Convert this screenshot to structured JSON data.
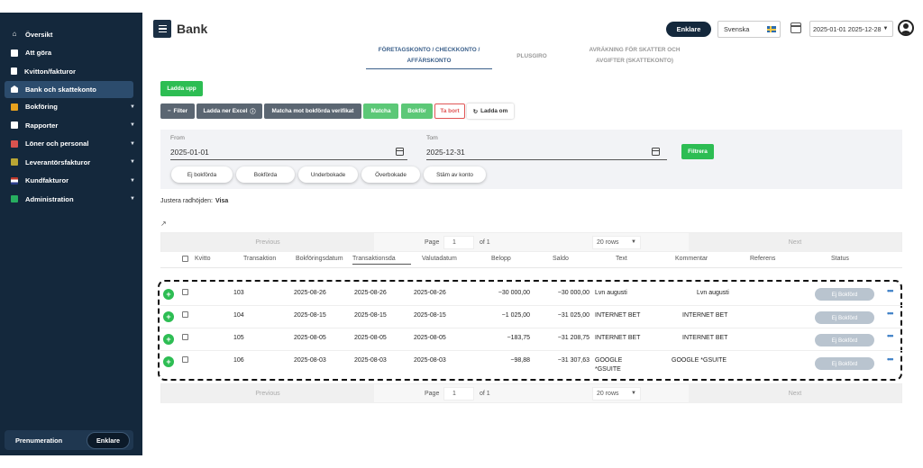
{
  "sidebar": {
    "items": [
      {
        "label": "Översikt",
        "icon": "house-icon"
      },
      {
        "label": "Att göra",
        "icon": "list-icon"
      },
      {
        "label": "Kvitton/fakturor",
        "icon": "document-icon"
      },
      {
        "label": "Bank och skattekonto",
        "icon": "bank-icon"
      },
      {
        "label": "Bokföring",
        "icon": "ledger-icon"
      },
      {
        "label": "Rapporter",
        "icon": "report-icon"
      },
      {
        "label": "Löner och personal",
        "icon": "payroll-icon"
      },
      {
        "label": "Leverantörsfakturor",
        "icon": "supplier-icon"
      },
      {
        "label": "Kundfakturor",
        "icon": "flag-icon"
      },
      {
        "label": "Administration",
        "icon": "admin-icon"
      }
    ],
    "bottom_label": "Prenumeration",
    "bottom_button": "Enklare"
  },
  "header": {
    "title": "Bank",
    "enklare": "Enklare",
    "language": "Svenska",
    "date_range": "2025-01-01 2025-12-28"
  },
  "tabs": {
    "t1_line1": "FÖRETAGSKONTO / CHECKKONTO /",
    "t1_line2": "AFFÄRSKONTO",
    "t2": "PLUSGIRO",
    "t3_line1": "AVRÄKNING FÖR SKATTER OCH",
    "t3_line2": "AVGIFTER (SKATTEKONTO)"
  },
  "toolbar": {
    "upload": "Ladda upp",
    "filter": "Filter",
    "download_excel": "Ladda ner Excel",
    "match_verifications": "Matcha mot bokförda verifikat",
    "match": "Matcha",
    "book": "Bokför",
    "delete": "Ta bort",
    "reload": "Ladda om"
  },
  "filters": {
    "from_label": "From",
    "from_value": "2025-01-01",
    "to_label": "Tom",
    "to_value": "2025-12-31",
    "filter_button": "Filtrera",
    "pills": [
      "Ej bokförda",
      "Bokförda",
      "Underbokade",
      "Överbokade",
      "Stäm av konto"
    ]
  },
  "row_height": {
    "label": "Justera radhöjden:",
    "value": "Visa"
  },
  "pager": {
    "previous": "Previous",
    "page_label": "Page",
    "page_value": "1",
    "of": "of 1",
    "rows": "20 rows",
    "next": "Next"
  },
  "columns": [
    "Kvitto",
    "Transaktion",
    "Bokföringsdatum",
    "Transaktionsda",
    "Valutadatum",
    "Belopp",
    "Saldo",
    "Text",
    "Kommentar",
    "Referens",
    "Status"
  ],
  "rows": [
    {
      "transaction": "103",
      "booking_date": "2025-08-26",
      "transaction_date": "2025-08-26",
      "value_date": "2025-08-26",
      "amount": "−30 000,00",
      "balance": "−30 000,00",
      "text": "Lvn augusti",
      "text2": "",
      "comment": "Lvn augusti",
      "status": "Ej Bokförd"
    },
    {
      "transaction": "104",
      "booking_date": "2025-08-15",
      "transaction_date": "2025-08-15",
      "value_date": "2025-08-15",
      "amount": "−1 025,00",
      "balance": "−31 025,00",
      "text": "INTERNET BET",
      "text2": "",
      "comment": "INTERNET BET",
      "status": "Ej Bokförd"
    },
    {
      "transaction": "105",
      "booking_date": "2025-08-05",
      "transaction_date": "2025-08-05",
      "value_date": "2025-08-05",
      "amount": "−183,75",
      "balance": "−31 208,75",
      "text": "INTERNET BET",
      "text2": "",
      "comment": "INTERNET BET",
      "status": "Ej Bokförd"
    },
    {
      "transaction": "106",
      "booking_date": "2025-08-03",
      "transaction_date": "2025-08-03",
      "value_date": "2025-08-03",
      "amount": "−98,88",
      "balance": "−31 307,63",
      "text": "GOOGLE",
      "text2": "*GSUITE",
      "comment": "GOOGLE *GSUITE",
      "status": "Ej Bokförd"
    }
  ],
  "colors": {
    "sidebar": "#14283c",
    "accent_green": "#2dbd53",
    "status_grey": "#b9c4cf"
  }
}
